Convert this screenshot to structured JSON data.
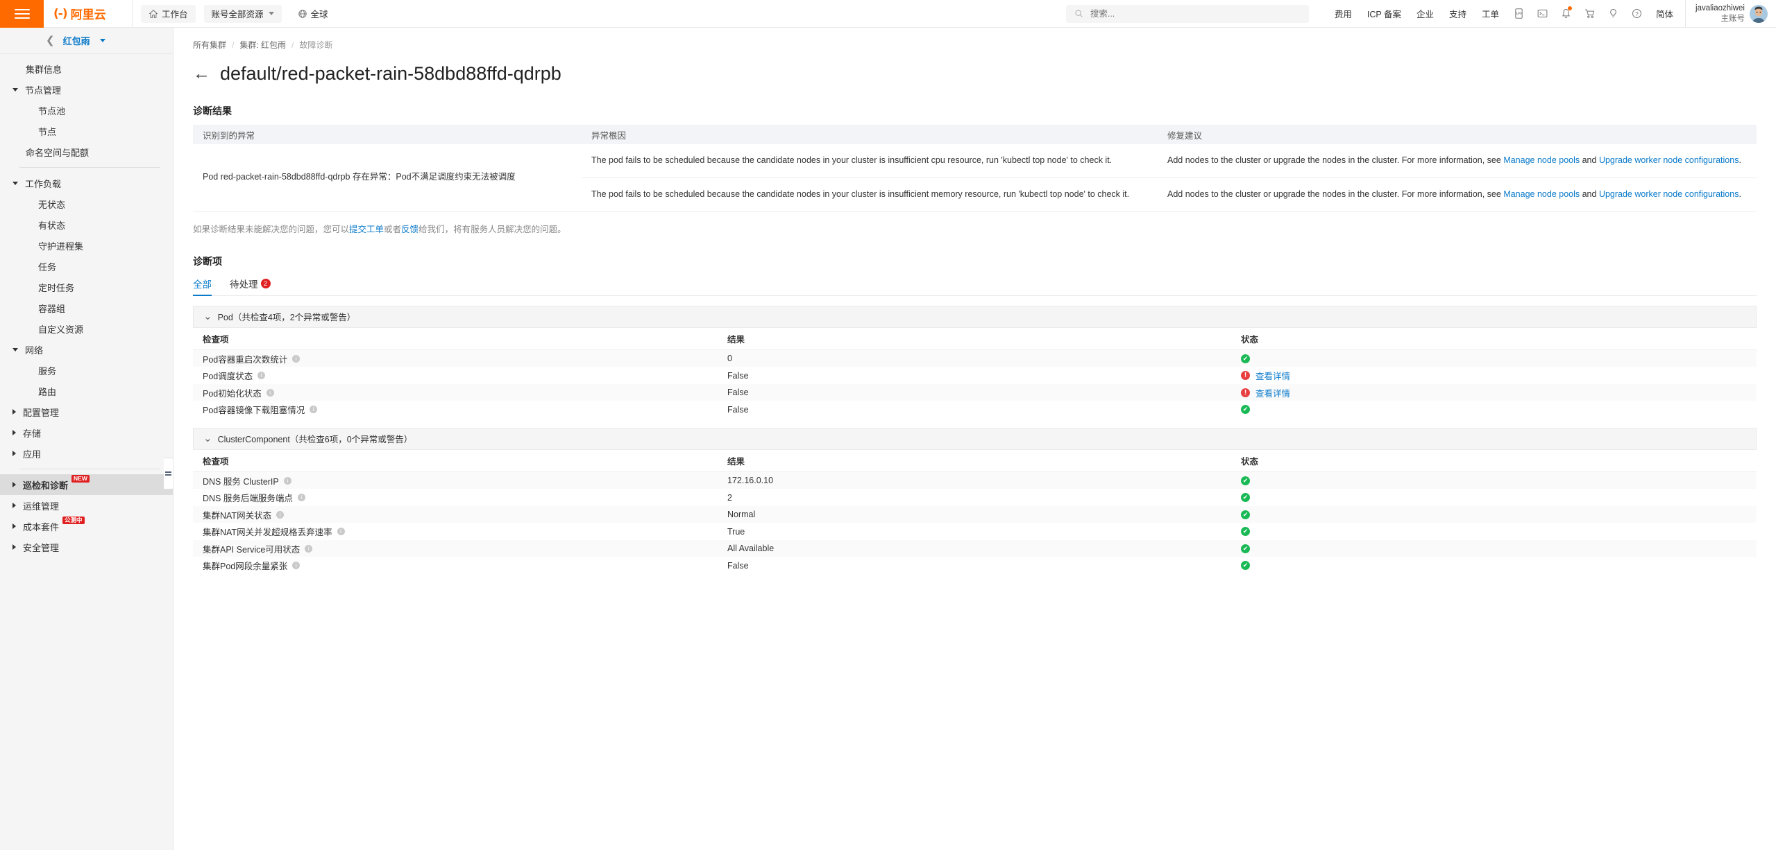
{
  "header": {
    "logo_text": "阿里云",
    "logo_mark": "(-)",
    "workbench": "工作台",
    "resource_scope": "账号全部资源",
    "region": "全球",
    "search_placeholder": "搜索...",
    "links": [
      "费用",
      "ICP 备案",
      "企业",
      "支持",
      "工单"
    ],
    "icons": [
      "app-icon",
      "terminal-icon",
      "bell-icon",
      "cart-icon",
      "bulb-icon",
      "help-icon"
    ],
    "language": "简体",
    "user_name": "javaliaozhiwei",
    "user_role": "主账号"
  },
  "sidebar": {
    "cluster_name": "红包雨",
    "items": [
      {
        "label": "集群信息",
        "level": 0,
        "arrow": "none",
        "active": false
      },
      {
        "label": "节点管理",
        "level": 0,
        "arrow": "down",
        "active": false
      },
      {
        "label": "节点池",
        "level": 1,
        "arrow": "none",
        "active": false
      },
      {
        "label": "节点",
        "level": 1,
        "arrow": "none",
        "active": false
      },
      {
        "label": "命名空间与配额",
        "level": 0,
        "arrow": "none",
        "active": false
      },
      {
        "separator": true
      },
      {
        "label": "工作负载",
        "level": 0,
        "arrow": "down",
        "active": false
      },
      {
        "label": "无状态",
        "level": 1,
        "arrow": "none",
        "active": false
      },
      {
        "label": "有状态",
        "level": 1,
        "arrow": "none",
        "active": false
      },
      {
        "label": "守护进程集",
        "level": 1,
        "arrow": "none",
        "active": false
      },
      {
        "label": "任务",
        "level": 1,
        "arrow": "none",
        "active": false
      },
      {
        "label": "定时任务",
        "level": 1,
        "arrow": "none",
        "active": false
      },
      {
        "label": "容器组",
        "level": 1,
        "arrow": "none",
        "active": false
      },
      {
        "label": "自定义资源",
        "level": 1,
        "arrow": "none",
        "active": false
      },
      {
        "label": "网络",
        "level": 0,
        "arrow": "down",
        "active": false
      },
      {
        "label": "服务",
        "level": 1,
        "arrow": "none",
        "active": false
      },
      {
        "label": "路由",
        "level": 1,
        "arrow": "none",
        "active": false
      },
      {
        "label": "配置管理",
        "level": 0,
        "arrow": "right",
        "active": false
      },
      {
        "label": "存储",
        "level": 0,
        "arrow": "right",
        "active": false
      },
      {
        "label": "应用",
        "level": 0,
        "arrow": "right",
        "active": false
      },
      {
        "separator": true
      },
      {
        "label": "巡检和诊断",
        "level": 0,
        "arrow": "right",
        "active": true,
        "tag": "NEW"
      },
      {
        "label": "运维管理",
        "level": 0,
        "arrow": "right",
        "active": false
      },
      {
        "label": "成本套件",
        "level": 0,
        "arrow": "right",
        "active": false,
        "tag": "公测中"
      },
      {
        "label": "安全管理",
        "level": 0,
        "arrow": "right",
        "active": false
      }
    ]
  },
  "breadcrumb": [
    {
      "label": "所有集群",
      "last": false
    },
    {
      "label": "集群: 红包雨",
      "last": false
    },
    {
      "label": "故障诊断",
      "last": true
    }
  ],
  "page": {
    "title": "default/red-packet-rain-58dbd88ffd-qdrpb",
    "back_arrow": "←"
  },
  "diagnosis_result": {
    "section_title": "诊断结果",
    "columns": [
      "识别到的异常",
      "异常根因",
      "修复建议"
    ],
    "anomaly": "Pod red-packet-rain-58dbd88ffd-qdrpb 存在异常：Pod不满足调度约束无法被调度",
    "rows": [
      {
        "cause": "The pod fails to be scheduled because the candidate nodes in your cluster is insufficient cpu resource, run 'kubectl top node' to check it.",
        "advice_prefix": "Add nodes to the cluster or upgrade the nodes in the cluster. For more information, see ",
        "advice_link1": "Manage node pools",
        "advice_mid": " and ",
        "advice_link2": "Upgrade worker node configurations",
        "advice_suffix": "."
      },
      {
        "cause": "The pod fails to be scheduled because the candidate nodes in your cluster is insufficient memory resource, run 'kubectl top node' to check it.",
        "advice_prefix": "Add nodes to the cluster or upgrade the nodes in the cluster. For more information, see ",
        "advice_link1": "Manage node pools",
        "advice_mid": " and ",
        "advice_link2": "Upgrade worker node configurations",
        "advice_suffix": "."
      }
    ],
    "note_prefix": "如果诊断结果未能解决您的问题，您可以",
    "note_link1": "提交工单",
    "note_mid": "或者",
    "note_link2": "反馈",
    "note_suffix": "给我们，将有服务人员解决您的问题。"
  },
  "diagnosis_items": {
    "section_title": "诊断项",
    "tabs": [
      {
        "label": "全部",
        "active": true,
        "count": null
      },
      {
        "label": "待处理",
        "active": false,
        "count": "2"
      }
    ],
    "groups": [
      {
        "title": "Pod（共检查4项，2个异常或警告）",
        "columns": [
          "检查项",
          "结果",
          "状态"
        ],
        "rows": [
          {
            "name": "Pod容器重启次数统计",
            "result": "0",
            "status": "ok",
            "detail": null
          },
          {
            "name": "Pod调度状态",
            "result": "False",
            "status": "error",
            "detail": "查看详情"
          },
          {
            "name": "Pod初始化状态",
            "result": "False",
            "status": "error",
            "detail": "查看详情"
          },
          {
            "name": "Pod容器镜像下载阻塞情况",
            "result": "False",
            "status": "ok",
            "detail": null
          }
        ]
      },
      {
        "title": "ClusterComponent（共检查6项，0个异常或警告）",
        "columns": [
          "检查项",
          "结果",
          "状态"
        ],
        "rows": [
          {
            "name": "DNS 服务 ClusterIP",
            "result": "172.16.0.10",
            "status": "ok",
            "detail": null
          },
          {
            "name": "DNS 服务后端服务端点",
            "result": "2",
            "status": "ok",
            "detail": null
          },
          {
            "name": "集群NAT网关状态",
            "result": "Normal",
            "status": "ok",
            "detail": null
          },
          {
            "name": "集群NAT网关并发超规格丢弃速率",
            "result": "True",
            "status": "ok",
            "detail": null
          },
          {
            "name": "集群API Service可用状态",
            "result": "All Available",
            "status": "ok",
            "detail": null
          },
          {
            "name": "集群Pod网段余量紧张",
            "result": "False",
            "status": "ok",
            "detail": null
          }
        ]
      }
    ]
  },
  "colors": {
    "brand_orange": "#ff6a00",
    "link_blue": "#0a7aca",
    "ok_green": "#19b955",
    "error_red": "#e84040",
    "badge_red": "#e02020"
  }
}
